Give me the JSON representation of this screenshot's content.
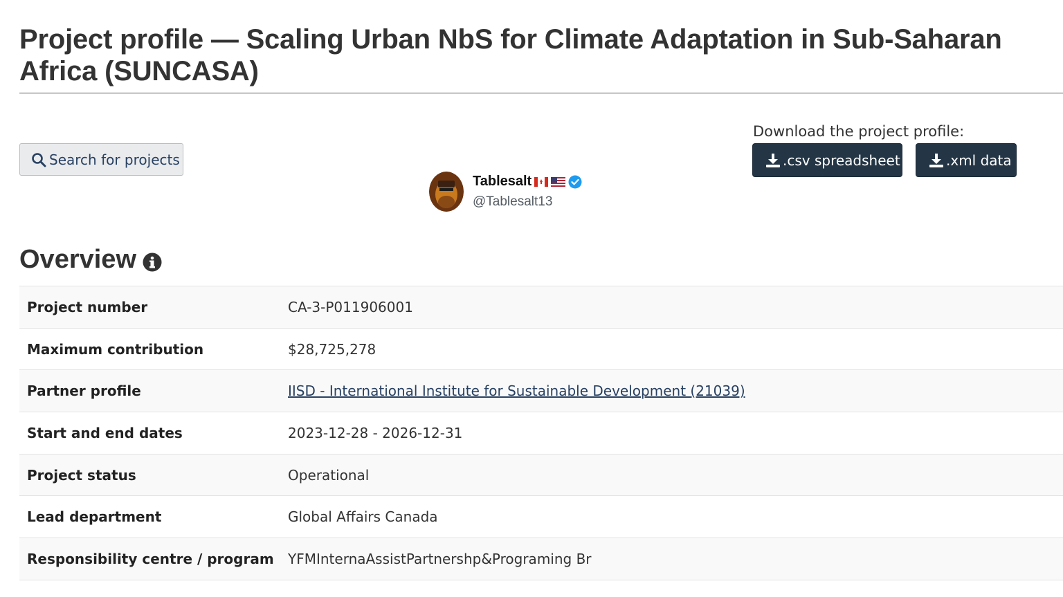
{
  "header": {
    "title": "Project profile — Scaling Urban NbS for Climate Adaptation in Sub-Saharan Africa (SUNCASA)"
  },
  "toolbar": {
    "search_label": "Search for projects",
    "download_label": "Download the project profile:",
    "csv_label": ".csv spreadsheet",
    "xml_label": ".xml data"
  },
  "watermark": {
    "name": "Tablesalt",
    "handle": "@Tablesalt13"
  },
  "overview": {
    "heading": "Overview",
    "rows": [
      {
        "label": "Project number",
        "value": "CA-3-P011906001"
      },
      {
        "label": "Maximum contribution",
        "value": "$28,725,278"
      },
      {
        "label": "Partner profile",
        "value": "IISD - International Institute for Sustainable Development (21039)"
      },
      {
        "label": "Start and end dates",
        "value": "2023-12-28 - 2026-12-31"
      },
      {
        "label": "Project status",
        "value": "Operational"
      },
      {
        "label": "Lead department",
        "value": "Global Affairs Canada"
      },
      {
        "label": "Responsibility centre / program",
        "value": "YFMInternaAssistPartnershp&Programing Br"
      }
    ]
  },
  "colors": {
    "download_button": "#243646",
    "search_button_bg": "#eaebed",
    "link": "#284162",
    "verified": "#1d9bf0"
  },
  "icons": {
    "search": "search-icon",
    "download": "download-icon",
    "info": "info-icon",
    "verified": "verified-badge-icon"
  }
}
